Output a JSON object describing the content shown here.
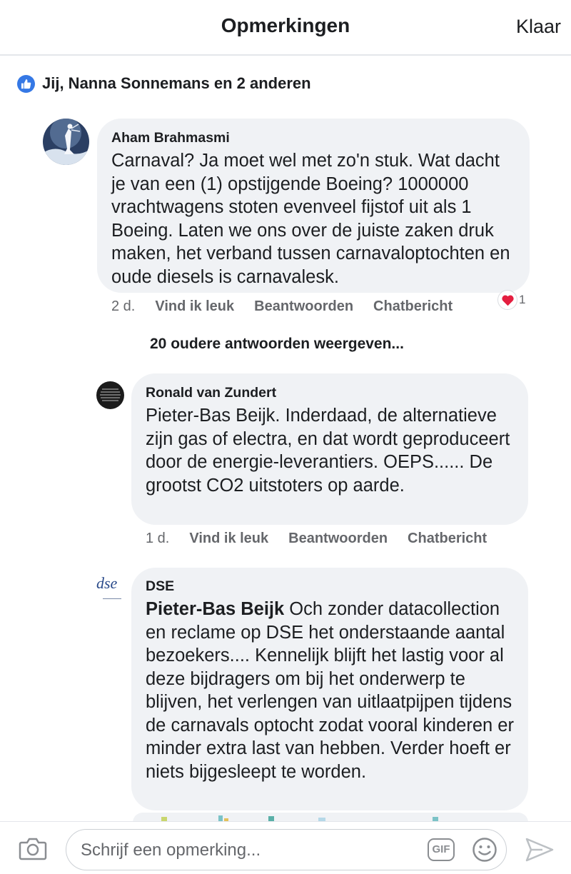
{
  "header": {
    "title": "Opmerkingen",
    "done_label": "Klaar"
  },
  "reactions": {
    "text": "Jij, Nanna Sonnemans en 2 anderen",
    "icon": "like-icon",
    "color": "#3578e5"
  },
  "comments": [
    {
      "author": "Aham Brahmasmi",
      "text": "Carnaval? Ja moet wel met zo'n stuk. Wat dacht je van een (1) opstijgende Boeing? 1000000 vrachtwagens stoten evenveel fijstof uit als 1 Boeing. Laten we ons over de juiste zaken druk maken, het verband tussen carnavaloptochten en oude diesels is carnavalesk.",
      "time": "2 d.",
      "like_label": "Vind ik leuk",
      "reply_label": "Beantwoorden",
      "chat_label": "Chatbericht",
      "reaction_icon": "heart-icon",
      "reaction_count": "1"
    }
  ],
  "more_replies_label": "20 oudere antwoorden weergeven...",
  "replies": [
    {
      "author": "Ronald van Zundert",
      "text": "Pieter-Bas Beijk. Inderdaad, de alternatieve zijn gas of electra, en dat wordt geproduceert door de energie-leverantiers. OEPS...... De grootst CO2 uitstoters op aarde.",
      "time": "1 d.",
      "like_label": "Vind ik leuk",
      "reply_label": "Beantwoorden",
      "chat_label": "Chatbericht"
    },
    {
      "author": "DSE",
      "avatar_text": "dse",
      "mention": "Pieter-Bas Beijk",
      "text": " Och zonder datacollection en reclame op DSE het onderstaande aantal bezoekers.... Kennelijk blijft het lastig voor al deze bijdragers om bij het onderwerp te blijven, het verlengen van uitlaatpijpen tijdens de carnavals optocht zodat vooral kinderen er minder extra last van hebben. Verder hoeft er niets bijgesleept te worden."
    }
  ],
  "composer": {
    "placeholder": "Schrijf een opmerking...",
    "gif_label": "GIF",
    "camera_icon": "camera-icon",
    "emoji_icon": "smiley-icon",
    "send_icon": "send-icon"
  }
}
